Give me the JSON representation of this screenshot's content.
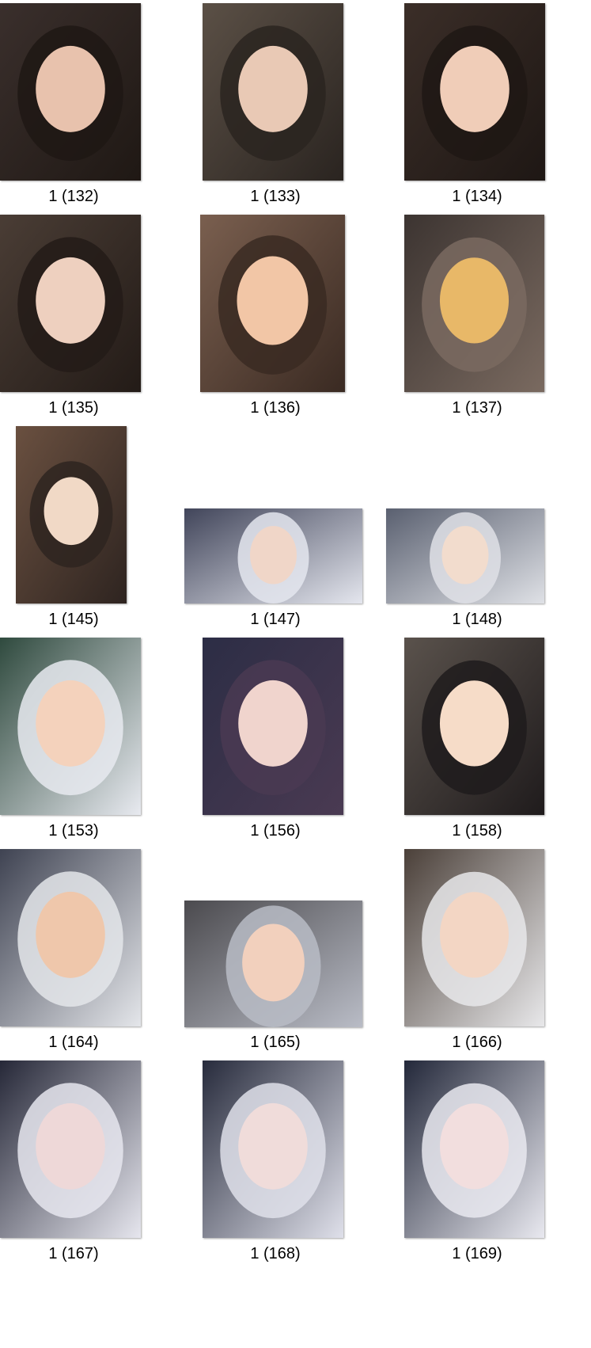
{
  "items": [
    {
      "label": "1 (132)",
      "colors": [
        "#3a2f2c",
        "#e8c2ad",
        "#1f1814"
      ]
    },
    {
      "label": "1 (133)",
      "colors": [
        "#5b5046",
        "#e9c9b5",
        "#2a2420"
      ]
    },
    {
      "label": "1 (134)",
      "colors": [
        "#3b2e28",
        "#f0cdb8",
        "#1e1714"
      ]
    },
    {
      "label": "1 (135)",
      "colors": [
        "#4a3d35",
        "#eed0bf",
        "#231b17"
      ]
    },
    {
      "label": "1 (136)",
      "colors": [
        "#7a5f4f",
        "#f2c6a6",
        "#3a2a22"
      ]
    },
    {
      "label": "1 (137)",
      "colors": [
        "#3c3431",
        "#e8b868",
        "#7a6a60"
      ]
    },
    {
      "label": "1 (145)",
      "colors": [
        "#6a5040",
        "#f1d9c6",
        "#2e2420"
      ]
    },
    {
      "label": "1 (147)",
      "colors": [
        "#41455a",
        "#f0d6c8",
        "#e4e6ee"
      ]
    },
    {
      "label": "1 (148)",
      "colors": [
        "#5a6070",
        "#f2dccd",
        "#dfe1e6"
      ]
    },
    {
      "label": "1 (153)",
      "colors": [
        "#2f4a3e",
        "#f4d2bc",
        "#e8eaf0"
      ]
    },
    {
      "label": "1 (156)",
      "colors": [
        "#2c2d45",
        "#f0d4cd",
        "#4a3a52"
      ]
    },
    {
      "label": "1 (158)",
      "colors": [
        "#5a524c",
        "#f6dcc8",
        "#1f1b1c"
      ]
    },
    {
      "label": "1 (164)",
      "colors": [
        "#3f4352",
        "#efc7ab",
        "#e4e6ea"
      ]
    },
    {
      "label": "1 (165)",
      "colors": [
        "#4b4a4e",
        "#f2d0bd",
        "#b9bcc6"
      ]
    },
    {
      "label": "1 (166)",
      "colors": [
        "#4b4039",
        "#f3d6c4",
        "#e8e8ea"
      ]
    },
    {
      "label": "1 (167)",
      "colors": [
        "#262838",
        "#eed8d8",
        "#e6e6ee"
      ]
    },
    {
      "label": "1 (168)",
      "colors": [
        "#272b3c",
        "#f0dcda",
        "#dfe0ea"
      ]
    },
    {
      "label": "1 (169)",
      "colors": [
        "#23283a",
        "#f2dede",
        "#e9e9f0"
      ]
    }
  ]
}
